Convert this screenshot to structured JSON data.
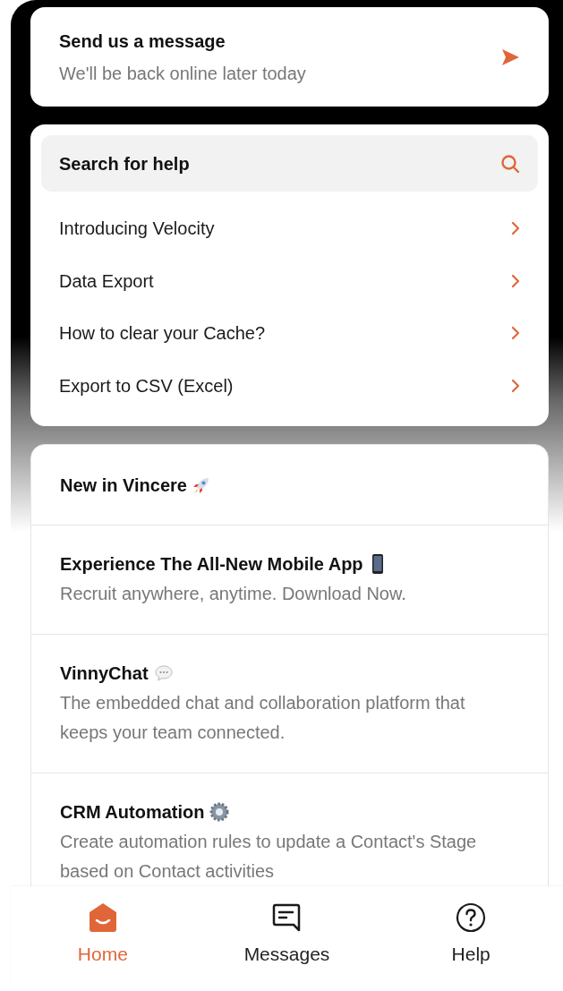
{
  "message_card": {
    "title": "Send us a message",
    "subtitle": "We'll be back online later today"
  },
  "help": {
    "search_label": "Search for help",
    "articles": [
      "Introducing Velocity",
      "Data Export",
      "How to clear your Cache?",
      "Export to CSV (Excel)"
    ]
  },
  "news": {
    "title": "New in Vincere",
    "items": [
      {
        "title": "Experience The All-New Mobile App",
        "text": "Recruit anywhere, anytime. Download Now."
      },
      {
        "title": "VinnyChat",
        "text": "The embedded chat and collaboration platform that keeps your team connected."
      },
      {
        "title": "CRM Automation",
        "text": "Create automation rules to update a Contact's Stage based on Contact activities"
      }
    ]
  },
  "nav": [
    {
      "kind": "home",
      "label": "Home",
      "selected": true
    },
    {
      "kind": "messages",
      "label": "Messages",
      "selected": false
    },
    {
      "kind": "help",
      "label": "Help",
      "selected": false
    }
  ]
}
